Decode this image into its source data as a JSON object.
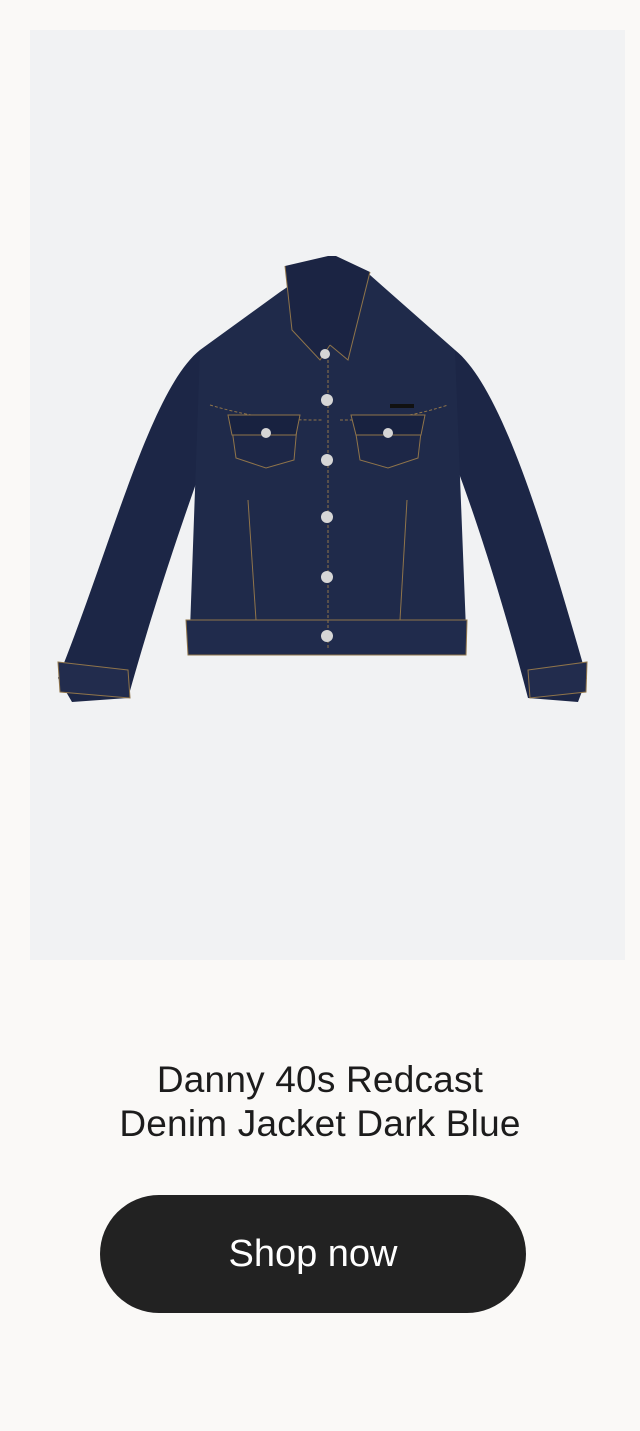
{
  "product": {
    "image_subject": "denim-jacket",
    "title_line1": "Danny 40s Redcast",
    "title_line2": "Denim Jacket Dark Blue",
    "cta_label": "Shop now"
  },
  "colors": {
    "page_background": "#faf9f7",
    "image_background": "#f1f2f3",
    "denim": "#1f2a4a",
    "denim_dark": "#172039",
    "stitching": "#9a7a4a",
    "button_background": "#222222",
    "button_text": "#ffffff",
    "title_text": "#1c1c1c"
  }
}
